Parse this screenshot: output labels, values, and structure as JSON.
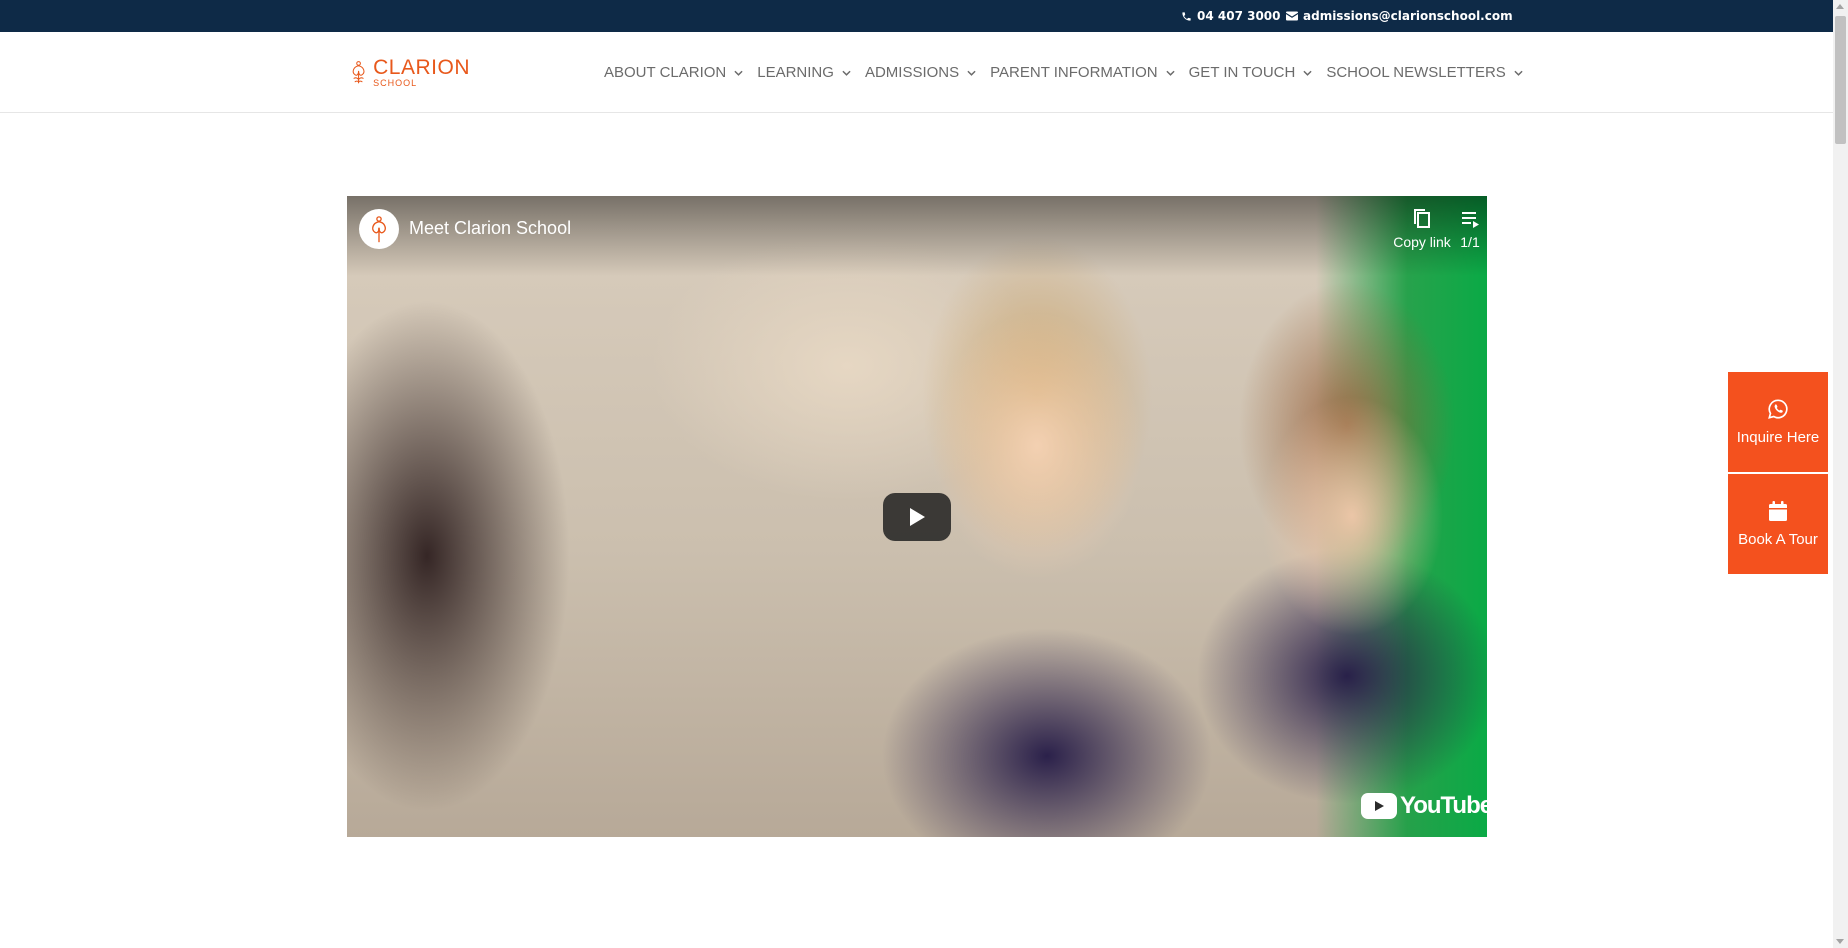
{
  "topbar": {
    "phone_icon": "phone-icon",
    "phone": "04 407 3000",
    "email_icon": "envelope-icon",
    "email": "admissions@clarionschool.com",
    "background": "#0e2a47"
  },
  "logo": {
    "name": "CLARION",
    "subtitle": "SCHOOL",
    "icon": "clarion-flower-logo-icon",
    "color": "#e8581b"
  },
  "nav": {
    "items": [
      {
        "label": "ABOUT CLARION",
        "icon": "chevron-down-icon"
      },
      {
        "label": "LEARNING",
        "icon": "chevron-down-icon"
      },
      {
        "label": "ADMISSIONS",
        "icon": "chevron-down-icon"
      },
      {
        "label": "PARENT INFORMATION",
        "icon": "chevron-down-icon"
      },
      {
        "label": "GET IN TOUCH",
        "icon": "chevron-down-icon"
      },
      {
        "label": "SCHOOL NEWSLETTERS",
        "icon": "chevron-down-icon"
      }
    ]
  },
  "video": {
    "title": "Meet Clarion School",
    "copy_link_label": "Copy link",
    "copy_icon": "copy-icon",
    "playlist_count": "1/1",
    "playlist_icon": "playlist-icon",
    "play_icon": "play-icon",
    "brand": "YouTube"
  },
  "cta": {
    "inquire_label": "Inquire Here",
    "inquire_icon": "whatsapp-icon",
    "tour_label": "Book A Tour",
    "tour_icon": "calendar-icon",
    "color": "#f4511e"
  }
}
